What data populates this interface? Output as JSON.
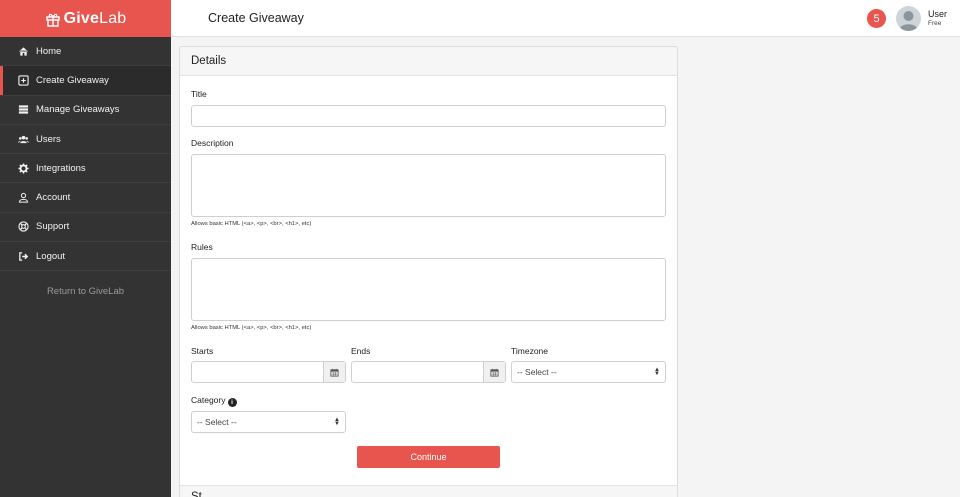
{
  "brand": {
    "name_bold": "Give",
    "name_rest": "Lab"
  },
  "sidebar": {
    "items": [
      {
        "label": "Home",
        "icon": "home-icon"
      },
      {
        "label": "Create Giveaway",
        "icon": "plus-square-icon",
        "active": true
      },
      {
        "label": "Manage Giveaways",
        "icon": "list-icon"
      },
      {
        "label": "Users",
        "icon": "users-icon"
      },
      {
        "label": "Integrations",
        "icon": "gear-icon"
      },
      {
        "label": "Account",
        "icon": "user-icon"
      },
      {
        "label": "Support",
        "icon": "lifebuoy-icon"
      },
      {
        "label": "Logout",
        "icon": "logout-icon"
      }
    ],
    "return_link": "Return to GiveLab"
  },
  "header": {
    "title": "Create Giveaway",
    "notification_count": "5",
    "user_name": "User",
    "user_plan": "Free"
  },
  "form": {
    "section_title": "Details",
    "title_label": "Title",
    "title_value": "",
    "description_label": "Description",
    "description_value": "",
    "description_help": "Allows basic HTML (<a>, <p>, <br>, <h1>, etc)",
    "rules_label": "Rules",
    "rules_value": "",
    "rules_help": "Allows basic HTML (<a>, <p>, <br>, <h1>, etc)",
    "starts_label": "Starts",
    "starts_value": "",
    "ends_label": "Ends",
    "ends_value": "",
    "timezone_label": "Timezone",
    "timezone_value": "-- Select --",
    "category_label": "Category",
    "category_value": "-- Select --",
    "continue_label": "Continue",
    "next_section_title": "St"
  },
  "colors": {
    "accent": "#e8554e",
    "sidebar_bg": "#333333"
  }
}
